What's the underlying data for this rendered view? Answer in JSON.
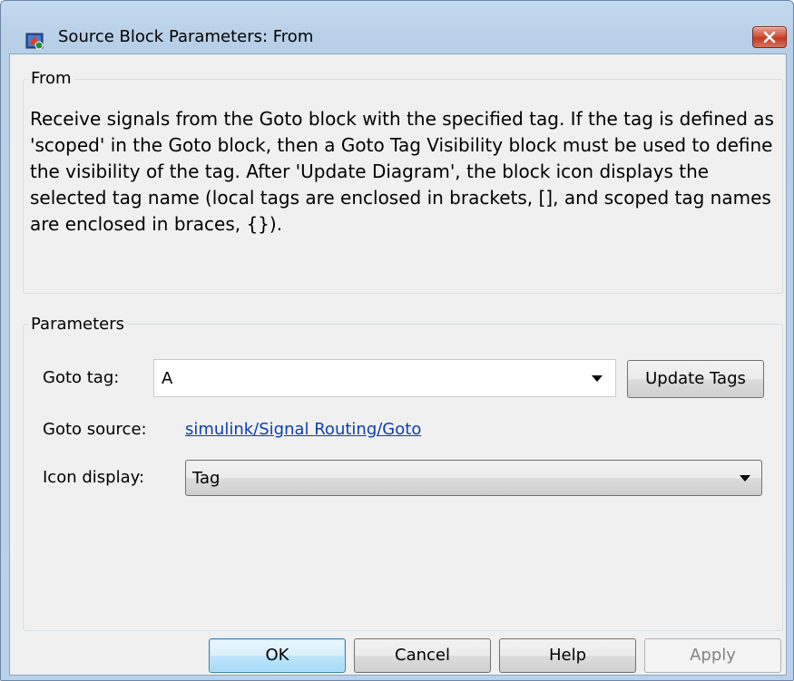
{
  "window": {
    "title": "Source Block Parameters: From",
    "close_icon": "close-icon",
    "app_icon": "simulink-block-icon"
  },
  "description_group": {
    "label": "From",
    "text": "Receive signals from the Goto block with the specified tag.  If the tag is defined as 'scoped' in the Goto block, then a Goto Tag Visibility block must be used to define the visibility of the tag.  After 'Update Diagram', the block icon displays the selected tag name  (local tags are enclosed in brackets, [], and scoped tag names are enclosed in braces, {})."
  },
  "parameters_group": {
    "label": "Parameters",
    "goto_tag": {
      "label": "Goto tag:",
      "value": "A",
      "update_button": "Update Tags"
    },
    "goto_source": {
      "label": "Goto source:",
      "link": "simulink/Signal Routing/Goto"
    },
    "icon_display": {
      "label": "Icon display:",
      "value": "Tag"
    }
  },
  "buttons": {
    "ok": "OK",
    "cancel": "Cancel",
    "help": "Help",
    "apply": "Apply"
  },
  "colors": {
    "link": "#0b3fb0",
    "close_button": "#c43a24",
    "default_button_border": "#3c7fb1"
  }
}
